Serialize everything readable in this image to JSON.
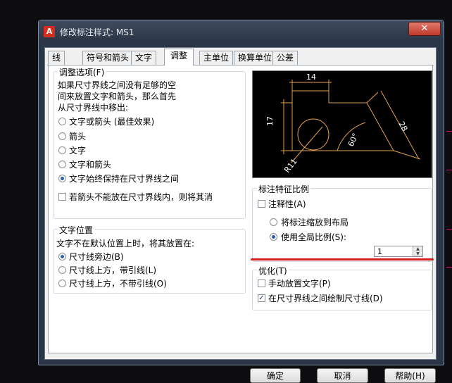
{
  "window": {
    "title": "修改标注样式: MS1",
    "close_label": "✕"
  },
  "tabs": [
    {
      "label": "线"
    },
    {
      "label": "符号和箭头"
    },
    {
      "label": "文字"
    },
    {
      "label": "调整"
    },
    {
      "label": "主单位"
    },
    {
      "label": "换算单位"
    },
    {
      "label": "公差"
    }
  ],
  "active_tab": "调整",
  "fit_options": {
    "title": "调整选项(F)",
    "desc": [
      "如果尺寸界线之间没有足够的空",
      "间来放置文字和箭头，那么首先",
      "从尺寸界线中移出:"
    ],
    "options": [
      {
        "label": "文字或箭头 (最佳效果)",
        "selected": false
      },
      {
        "label": "箭头",
        "selected": false
      },
      {
        "label": "文字",
        "selected": false
      },
      {
        "label": "文字和箭头",
        "selected": false
      },
      {
        "label": "文字始终保持在尺寸界线之间",
        "selected": true
      }
    ],
    "suppress_arrows": {
      "label": "若箭头不能放在尺寸界线内，则将其消",
      "checked": false
    }
  },
  "text_placement": {
    "title": "文字位置",
    "desc": "文字不在默认位置上时，将其放置在:",
    "options": [
      {
        "label": "尺寸线旁边(B)",
        "selected": true
      },
      {
        "label": "尺寸线上方，带引线(L)",
        "selected": false
      },
      {
        "label": "尺寸线上方，不带引线(O)",
        "selected": false
      }
    ]
  },
  "preview": {
    "dim_14": "14",
    "dim_17": "17",
    "dim_28": "28",
    "dim_60": "60°",
    "dim_r11": "R11"
  },
  "scale": {
    "title": "标注特征比例",
    "annotative": {
      "label": "注释性(A)",
      "checked": false
    },
    "scale_to_layout": {
      "label": "将标注缩放到布局",
      "selected": false
    },
    "use_overall": {
      "label": "使用全局比例(S):",
      "selected": true
    },
    "overall_value": "1"
  },
  "fine_tuning": {
    "title": "优化(T)",
    "manual_text": {
      "label": "手动放置文字(P)",
      "checked": false
    },
    "draw_dim_line": {
      "label": "在尺寸界线之间绘制尺寸线(D)",
      "checked": true
    }
  },
  "buttons": {
    "ok": "确定",
    "cancel": "取消",
    "help": "帮助(H)"
  },
  "colors": {
    "highlight_underline": "#d61e1e",
    "preview_lines": "#e0a050",
    "preview_text": "#ffffff"
  }
}
